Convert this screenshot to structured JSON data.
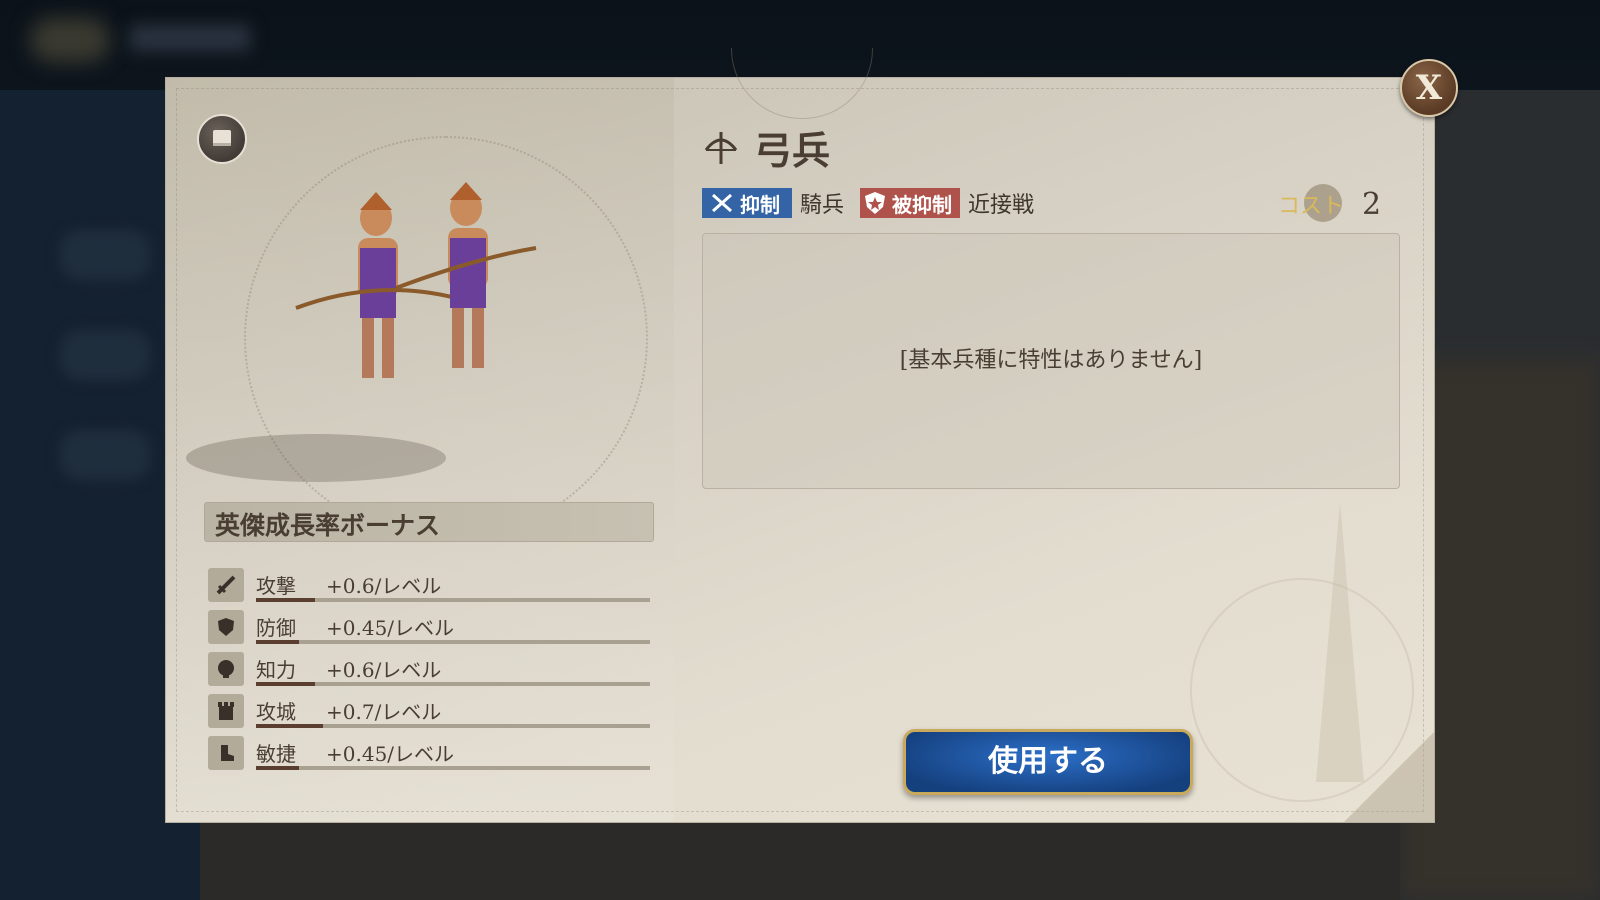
{
  "modal": {
    "close_label": "X",
    "unit_name": "弓兵",
    "tags": {
      "suppress_label": "抑制",
      "suppress_target": "騎兵",
      "suppressed_label": "被抑制",
      "suppressed_by": "近接戦"
    },
    "cost": {
      "label": "コスト",
      "value": "2"
    },
    "description": "[基本兵種に特性はありません]",
    "growth": {
      "title": "英傑成長率ボーナス",
      "stats": [
        {
          "name": "攻撃",
          "value": "+0.6/レベル",
          "icon": "sword-icon",
          "fill": 0.15
        },
        {
          "name": "防御",
          "value": "+0.45/レベル",
          "icon": "shield-icon",
          "fill": 0.11
        },
        {
          "name": "知力",
          "value": "+0.6/レベル",
          "icon": "head-icon",
          "fill": 0.15
        },
        {
          "name": "攻城",
          "value": "+0.7/レベル",
          "icon": "tower-icon",
          "fill": 0.17
        },
        {
          "name": "敏捷",
          "value": "+0.45/レベル",
          "icon": "boot-icon",
          "fill": 0.11
        }
      ]
    },
    "use_button_label": "使用する"
  },
  "colors": {
    "suppress_tag": "#3464a6",
    "suppressed_tag": "#b0524c",
    "use_button": "#1f58a8",
    "cost_label": "#d9b95a"
  }
}
